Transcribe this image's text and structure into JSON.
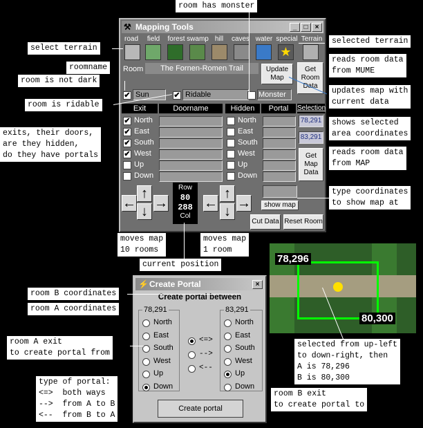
{
  "callouts": {
    "room_has_monster": "room has monster",
    "select_terrain": "select terrain",
    "selected_terrain": "selected terrain",
    "roomname": "roomname",
    "reads_room_data_mume": "reads room data\nfrom MUME",
    "room_not_dark": "room is not dark",
    "updates_map": "updates map with\ncurrent data",
    "room_ridable": "room is ridable",
    "shows_selected_area": "shows selected\narea coordinates",
    "exits_doors": "exits, their doors,\nare they hidden,\ndo they have portals",
    "reads_room_data_map": "reads room data\nfrom MAP",
    "type_coordinates": "type coordinates\nto show map at",
    "moves_10": "moves map\n10 rooms",
    "moves_1": "moves map\n1 room",
    "current_position": "current position",
    "room_b_coords": "room B coordinates",
    "room_a_coords": "room A coordinates",
    "room_a_exit": "room A exit\nto create portal from",
    "type_of_portal": "type of portal:\n<=>  both ways\n-->  from A to B\n<--  from B to A",
    "room_b_exit": "room B exit\nto create portal to",
    "selected_from": "selected from up-left\nto down-right, then\nA is 78,296\nB is 80,300"
  },
  "mapping_window": {
    "title": "Mapping Tools",
    "terrains": [
      "road",
      "field",
      "forest",
      "swamp",
      "hill",
      "caves",
      "water",
      "special"
    ],
    "terrain_header": "Terrain",
    "room_label": "Room",
    "room_name": "The Fornen-Romen Trail",
    "update_map": "Update\nMap",
    "get_room_data": "Get\nRoom\nData",
    "sun": "Sun",
    "ridable": "Ridable",
    "monster": "Monster",
    "exit_header": "Exit",
    "doorname_header": "Doorname",
    "hidden_header": "Hidden",
    "portal_header": "Portal",
    "selection_header": "Selection",
    "exits": [
      {
        "name": "North",
        "checked": true
      },
      {
        "name": "East",
        "checked": true
      },
      {
        "name": "South",
        "checked": true
      },
      {
        "name": "West",
        "checked": true
      },
      {
        "name": "Up",
        "checked": false
      },
      {
        "name": "Down",
        "checked": false
      }
    ],
    "hidden": [
      "North",
      "East",
      "South",
      "West",
      "Up",
      "Down"
    ],
    "selection_a": "78,291",
    "selection_b": "83,291",
    "get_map_data": "Get\nMap\nData",
    "row_label": "Row",
    "row_value": "80",
    "col_value": "288",
    "col_label": "Col",
    "show_map": "show map",
    "cut_data": "Cut Data",
    "reset_room": "Reset Room"
  },
  "map_preview": {
    "a_label": "78,296",
    "b_label": "80,300"
  },
  "portal_window": {
    "title": "Create Portal",
    "heading": "Create portal between",
    "a_coords": "78,291",
    "b_coords": "83,291",
    "directions": [
      "North",
      "East",
      "South",
      "West",
      "Up",
      "Down"
    ],
    "a_selected": "Down",
    "b_selected": "Up",
    "types": [
      "<=>",
      "-->",
      "<--"
    ],
    "type_selected": "<=>",
    "create_button": "Create portal"
  },
  "colors": {
    "accent": "#00ff00",
    "callout_bg": "#ffffff",
    "window_bg": "#6f6f6f"
  }
}
